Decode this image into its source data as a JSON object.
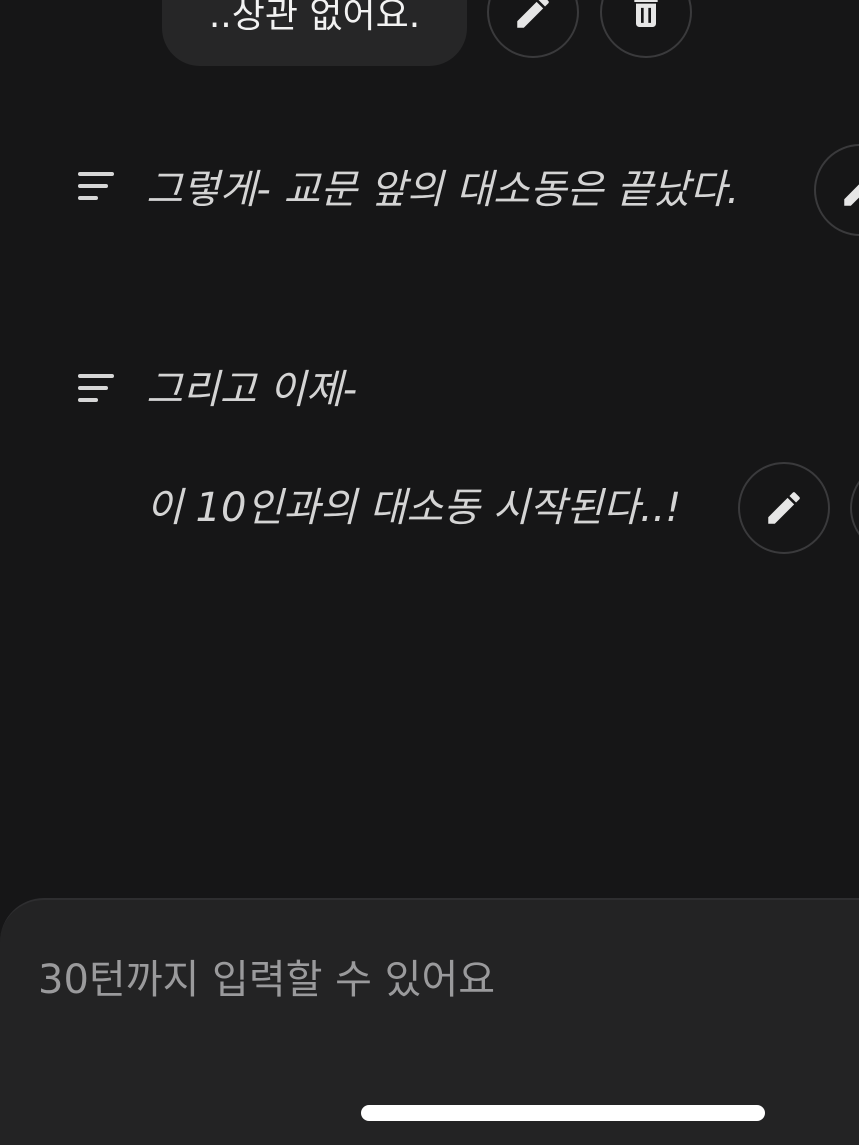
{
  "chat": {
    "user_bubble": {
      "text": "..상관 없어요."
    },
    "narration_1": {
      "text": "그렇게- 교문 앞의 대소동은 끝났다."
    },
    "narration_2": {
      "line1": "그리고 이제-",
      "line2": "이 10인과의 대소동 시작된다..!"
    }
  },
  "input": {
    "placeholder": "30턴까지 입력할 수 있어요"
  },
  "icons": {
    "edit": "pencil-icon",
    "delete": "trash-icon",
    "narration": "narration-lines-icon"
  },
  "colors": {
    "background": "#161617",
    "bubble": "#262627",
    "sheet": "#232324",
    "narration_text": "#d4d4d4",
    "placeholder": "#9a9a9c"
  }
}
